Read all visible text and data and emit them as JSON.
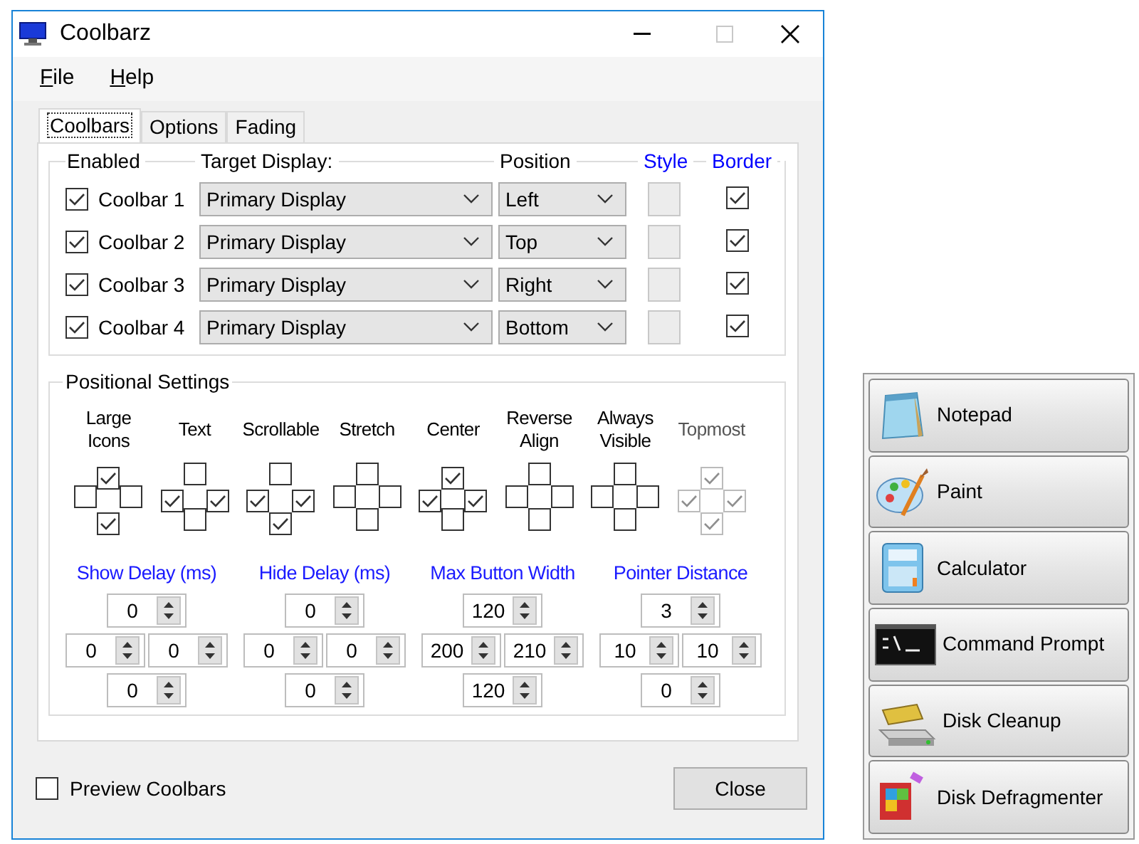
{
  "window": {
    "title": "Coolbarz"
  },
  "menu": [
    "File",
    "Help"
  ],
  "tabs": [
    {
      "label": "Coolbars",
      "selected": true
    },
    {
      "label": "Options",
      "selected": false
    },
    {
      "label": "Fading",
      "selected": false
    }
  ],
  "coolbars": {
    "headers": [
      {
        "label": "Enabled",
        "color": "#000000"
      },
      {
        "label": "Target Display:",
        "color": "#000000"
      },
      {
        "label": "Position",
        "color": "#000000"
      },
      {
        "label": "Style",
        "color": "#0000ff"
      },
      {
        "label": "Border",
        "color": "#0000ff"
      }
    ],
    "rows": [
      {
        "enabled": true,
        "name": "Coolbar 1",
        "display": "Primary Display",
        "position": "Left",
        "border": true
      },
      {
        "enabled": true,
        "name": "Coolbar 2",
        "display": "Primary Display",
        "position": "Top",
        "border": true
      },
      {
        "enabled": true,
        "name": "Coolbar 3",
        "display": "Primary Display",
        "position": "Right",
        "border": true
      },
      {
        "enabled": true,
        "name": "Coolbar 4",
        "display": "Primary Display",
        "position": "Bottom",
        "border": true
      }
    ]
  },
  "positional": {
    "title": "Positional Settings",
    "options": [
      {
        "label": "Large Icons",
        "disabled": false,
        "boxes": [
          {
            "kind": "top",
            "checked": true
          },
          {
            "kind": "left",
            "checked": false
          },
          {
            "kind": "right",
            "checked": false
          },
          {
            "kind": "bottom",
            "checked": true
          }
        ]
      },
      {
        "label": "Text",
        "disabled": false,
        "boxes": [
          {
            "kind": "top",
            "checked": false
          },
          {
            "kind": "left",
            "checked": true
          },
          {
            "kind": "right",
            "checked": true
          },
          {
            "kind": "bottom",
            "checked": false
          }
        ]
      },
      {
        "label": "Scrollable",
        "disabled": false,
        "boxes": [
          {
            "kind": "top",
            "checked": false
          },
          {
            "kind": "left",
            "checked": true
          },
          {
            "kind": "right",
            "checked": true
          },
          {
            "kind": "bottom",
            "checked": true
          }
        ]
      },
      {
        "label": "Stretch",
        "disabled": false,
        "boxes": [
          {
            "kind": "top",
            "checked": false
          },
          {
            "kind": "left",
            "checked": false
          },
          {
            "kind": "right",
            "checked": false
          },
          {
            "kind": "bottom",
            "checked": false
          }
        ]
      },
      {
        "label": "Center",
        "disabled": false,
        "boxes": [
          {
            "kind": "top",
            "checked": true
          },
          {
            "kind": "left",
            "checked": true
          },
          {
            "kind": "right",
            "checked": true
          },
          {
            "kind": "bottom",
            "checked": false
          }
        ]
      },
      {
        "label": "Reverse Align",
        "disabled": false,
        "boxes": [
          {
            "kind": "top",
            "checked": false
          },
          {
            "kind": "left",
            "checked": false
          },
          {
            "kind": "right",
            "checked": false
          },
          {
            "kind": "bottom",
            "checked": false
          }
        ]
      },
      {
        "label": "Always Visible",
        "disabled": false,
        "boxes": [
          {
            "kind": "top",
            "checked": false
          },
          {
            "kind": "left",
            "checked": false
          },
          {
            "kind": "right",
            "checked": false
          },
          {
            "kind": "bottom",
            "checked": false
          }
        ]
      },
      {
        "label": "Topmost",
        "disabled": true,
        "boxes": [
          {
            "kind": "top",
            "checked": true
          },
          {
            "kind": "left",
            "checked": true
          },
          {
            "kind": "right",
            "checked": true
          },
          {
            "kind": "bottom",
            "checked": true
          }
        ]
      }
    ],
    "spinners": [
      {
        "label": "Show Delay (ms)",
        "values": [
          {
            "kind": "top",
            "value": "0"
          },
          {
            "kind": "left",
            "value": "0"
          },
          {
            "kind": "right",
            "value": "0"
          },
          {
            "kind": "bottom",
            "value": "0"
          }
        ]
      },
      {
        "label": "Hide Delay (ms)",
        "values": [
          {
            "kind": "top",
            "value": "0"
          },
          {
            "kind": "left",
            "value": "0"
          },
          {
            "kind": "right",
            "value": "0"
          },
          {
            "kind": "bottom",
            "value": "0"
          }
        ]
      },
      {
        "label": "Max Button Width",
        "values": [
          {
            "kind": "top",
            "value": "120"
          },
          {
            "kind": "left",
            "value": "200"
          },
          {
            "kind": "right",
            "value": "210"
          },
          {
            "kind": "bottom",
            "value": "120"
          }
        ]
      },
      {
        "label": "Pointer Distance",
        "values": [
          {
            "kind": "top",
            "value": "3"
          },
          {
            "kind": "left",
            "value": "10"
          },
          {
            "kind": "right",
            "value": "10"
          },
          {
            "kind": "bottom",
            "value": "0"
          }
        ]
      }
    ]
  },
  "preview": {
    "label": "Preview Coolbars",
    "checked": false
  },
  "close_button": "Close",
  "launcher": [
    {
      "label": "Notepad",
      "kind": "notepad"
    },
    {
      "label": "Paint",
      "kind": "paint"
    },
    {
      "label": "Calculator",
      "kind": "calculator"
    },
    {
      "label": "Command Prompt",
      "kind": "console"
    },
    {
      "label": "Disk Cleanup",
      "kind": "cleanup"
    },
    {
      "label": "Disk Defragmenter",
      "kind": "defrag"
    }
  ]
}
